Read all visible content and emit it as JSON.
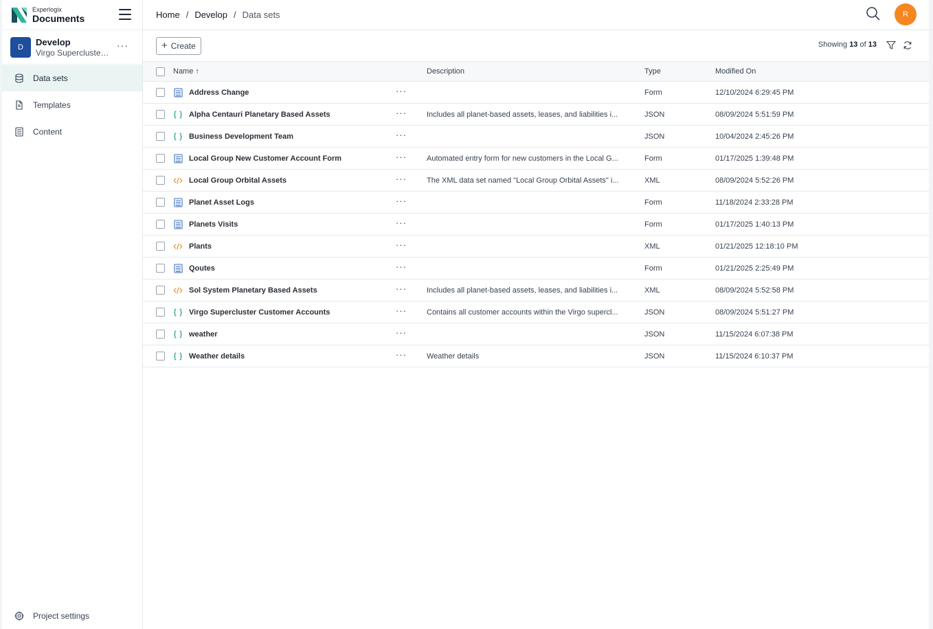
{
  "brand": {
    "small": "Experlogix",
    "big": "Documents"
  },
  "project": {
    "initial": "D",
    "name": "Develop",
    "subtitle": "Virgo Superclus­te…"
  },
  "nav": {
    "items": [
      {
        "label": "Data sets",
        "icon": "database-icon"
      },
      {
        "label": "Templates",
        "icon": "file-icon"
      },
      {
        "label": "Content",
        "icon": "content-icon"
      }
    ],
    "settings": "Project settings"
  },
  "breadcrumb": {
    "home": "Home",
    "sep1": "/",
    "develop": "Develop",
    "sep2": "/",
    "current": "Data sets"
  },
  "user": {
    "initial": "R",
    "color": "#f6861f"
  },
  "toolbar": {
    "create_label": "Create",
    "showing_prefix": "Showing",
    "showing_count": "13",
    "showing_of": "of",
    "showing_total": "13"
  },
  "table": {
    "headers": {
      "name": "Name",
      "sort": "↑",
      "description": "Description",
      "type": "Type",
      "modified": "Modified On"
    },
    "rows": [
      {
        "name": "Address Change",
        "desc": "",
        "type": "Form",
        "modified": "12/10/2024 6:29:45 PM",
        "icon": "form"
      },
      {
        "name": "Alpha Centauri Planetary Based Assets",
        "desc": "Includes all planet-based assets, leases, and liabilities i...",
        "type": "JSON",
        "modified": "08/09/2024 5:51:59 PM",
        "icon": "json"
      },
      {
        "name": "Business Development Team",
        "desc": "",
        "type": "JSON",
        "modified": "10/04/2024 2:45:26 PM",
        "icon": "json"
      },
      {
        "name": "Local Group New Customer Account Form",
        "desc": "Automated entry form for new customers in the Local G...",
        "type": "Form",
        "modified": "01/17/2025 1:39:48 PM",
        "icon": "form"
      },
      {
        "name": "Local Group Orbital Assets",
        "desc": "The XML data set named \"Local Group Orbital Assets\" i...",
        "type": "XML",
        "modified": "08/09/2024 5:52:26 PM",
        "icon": "xml"
      },
      {
        "name": "Planet Asset Logs",
        "desc": "",
        "type": "Form",
        "modified": "11/18/2024 2:33:28 PM",
        "icon": "form"
      },
      {
        "name": "Planets Visits",
        "desc": "",
        "type": "Form",
        "modified": "01/17/2025 1:40:13 PM",
        "icon": "form"
      },
      {
        "name": "Plants",
        "desc": "",
        "type": "XML",
        "modified": "01/21/2025 12:18:10 PM",
        "icon": "xml"
      },
      {
        "name": "Qoutes",
        "desc": "",
        "type": "Form",
        "modified": "01/21/2025 2:25:49 PM",
        "icon": "form"
      },
      {
        "name": "Sol System Planetary Based Assets",
        "desc": "Includes all planet-based assets, leases, and liabilities i...",
        "type": "XML",
        "modified": "08/09/2024 5:52:58 PM",
        "icon": "xml"
      },
      {
        "name": "Virgo Supercluster Customer Accounts",
        "desc": "Contains all customer accounts within the Virgo supercl...",
        "type": "JSON",
        "modified": "08/09/2024 5:51:27 PM",
        "icon": "json"
      },
      {
        "name": "weather",
        "desc": "",
        "type": "JSON",
        "modified": "11/15/2024 6:07:38 PM",
        "icon": "json"
      },
      {
        "name": "Weather details",
        "desc": "Weather details",
        "type": "JSON",
        "modified": "11/15/2024 6:10:37 PM",
        "icon": "json"
      }
    ]
  },
  "colors": {
    "accent_blue": "#1e4e9c",
    "json_green": "#1f9d7a",
    "xml_orange": "#e8841d",
    "form_blue": "#3b6fc2",
    "active_nav": "#e9f4f3"
  }
}
